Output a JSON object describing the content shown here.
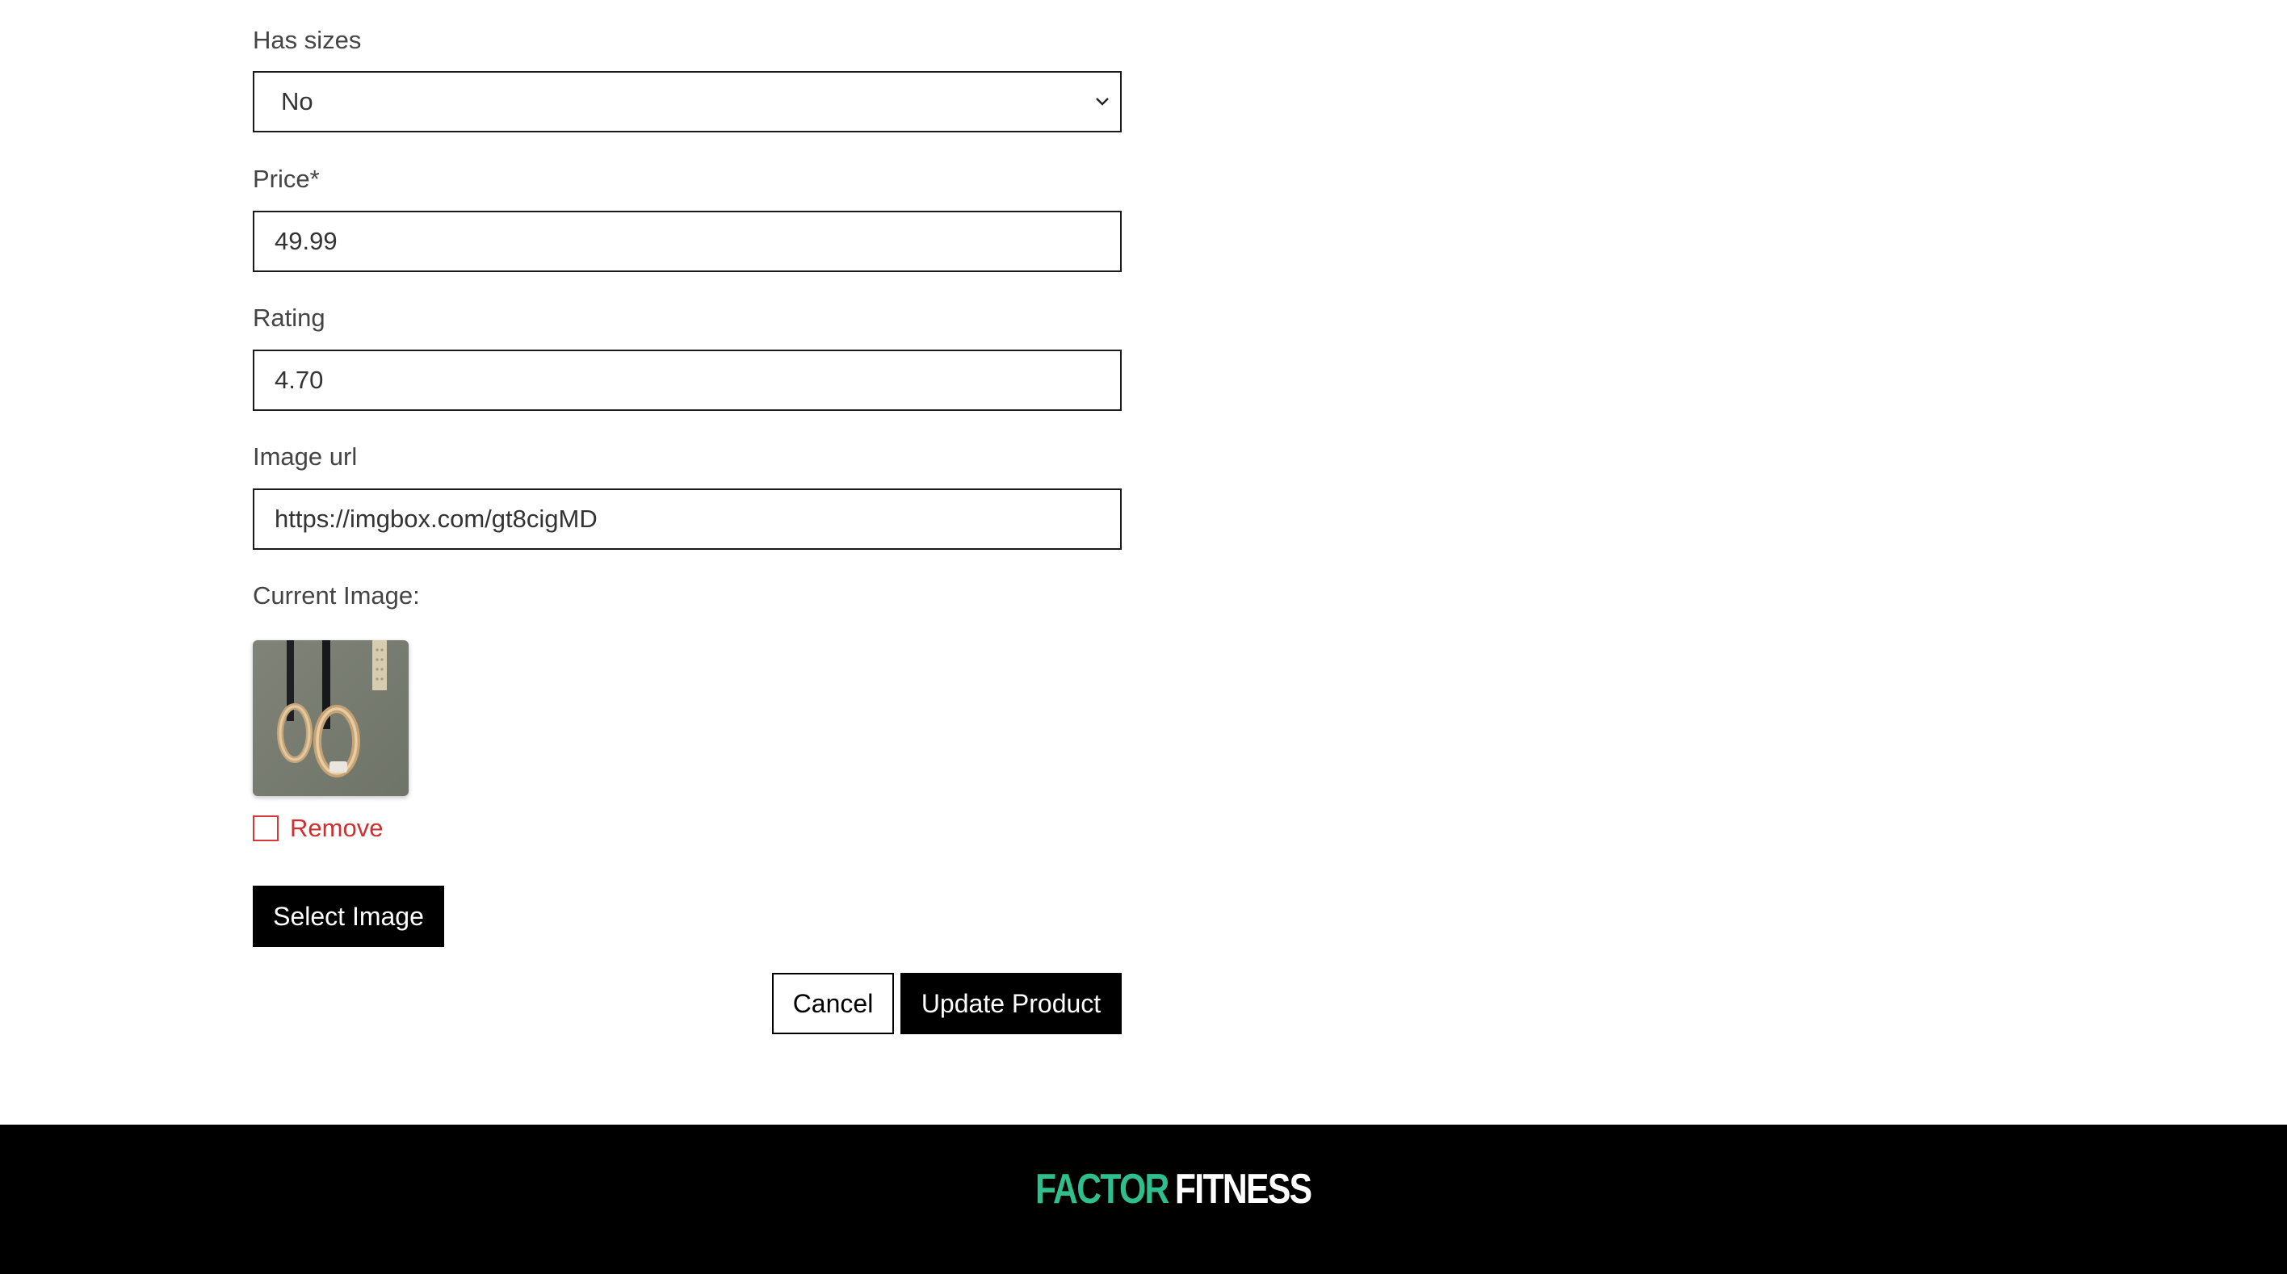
{
  "form": {
    "has_sizes": {
      "label": "Has sizes",
      "value": "No"
    },
    "price": {
      "label": "Price*",
      "value": "49.99"
    },
    "rating": {
      "label": "Rating",
      "value": "4.70"
    },
    "image_url": {
      "label": "Image url",
      "value": "https://imgbox.com/gt8cigMD"
    },
    "current_image_label": "Current Image:",
    "remove_label": "Remove",
    "remove_checked": false,
    "select_image_label": "Select Image",
    "cancel_label": "Cancel",
    "submit_label": "Update Product"
  },
  "footer": {
    "logo_part1": "FACTOR",
    "logo_part2": "FITNESS"
  },
  "colors": {
    "accent_logo": "#2fbf8f",
    "danger": "#cf2f2f",
    "button_bg": "#000000"
  }
}
